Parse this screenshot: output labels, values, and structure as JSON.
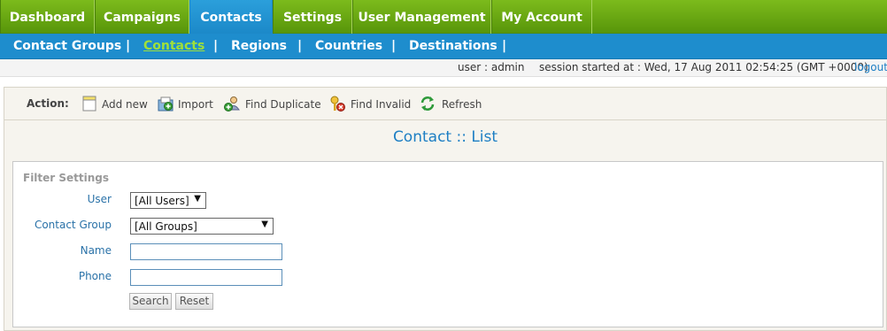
{
  "top_nav": {
    "tabs": [
      {
        "label": "Dashboard"
      },
      {
        "label": "Campaigns"
      },
      {
        "label": "Contacts"
      },
      {
        "label": "Settings"
      },
      {
        "label": "User Management"
      },
      {
        "label": "My Account"
      }
    ],
    "active": "Contacts"
  },
  "sub_nav": {
    "items": [
      {
        "label": "Contact Groups"
      },
      {
        "label": "Contacts"
      },
      {
        "label": "Regions"
      },
      {
        "label": "Countries"
      },
      {
        "label": "Destinations"
      }
    ],
    "separator": "|",
    "active": "Contacts"
  },
  "status": {
    "user": "user : admin",
    "session": "session started at : Wed, 17 Aug 2011 02:54:25 (GMT +0000)",
    "logout": "logout"
  },
  "action_bar": {
    "label": "Action:",
    "actions": [
      {
        "label": "Add new",
        "icon": "add-new-icon"
      },
      {
        "label": "Import",
        "icon": "import-icon"
      },
      {
        "label": "Find Duplicate",
        "icon": "find-duplicate-icon"
      },
      {
        "label": "Find Invalid",
        "icon": "find-invalid-icon"
      },
      {
        "label": "Refresh",
        "icon": "refresh-icon"
      }
    ]
  },
  "page_title": "Contact :: List",
  "filter": {
    "legend": "Filter Settings",
    "user_label": "User",
    "user_value": "[All Users]",
    "group_label": "Contact Group",
    "group_value": "[All Groups]",
    "name_label": "Name",
    "name_value": "",
    "phone_label": "Phone",
    "phone_value": "",
    "search_button": "Search",
    "reset_button": "Reset"
  },
  "colors": {
    "top_nav": "#6aaa14",
    "active_tab": "#2196d6",
    "sub_nav": "#1e8dcd",
    "active_sub": "#9fe03a",
    "title": "#1e7fc4"
  }
}
